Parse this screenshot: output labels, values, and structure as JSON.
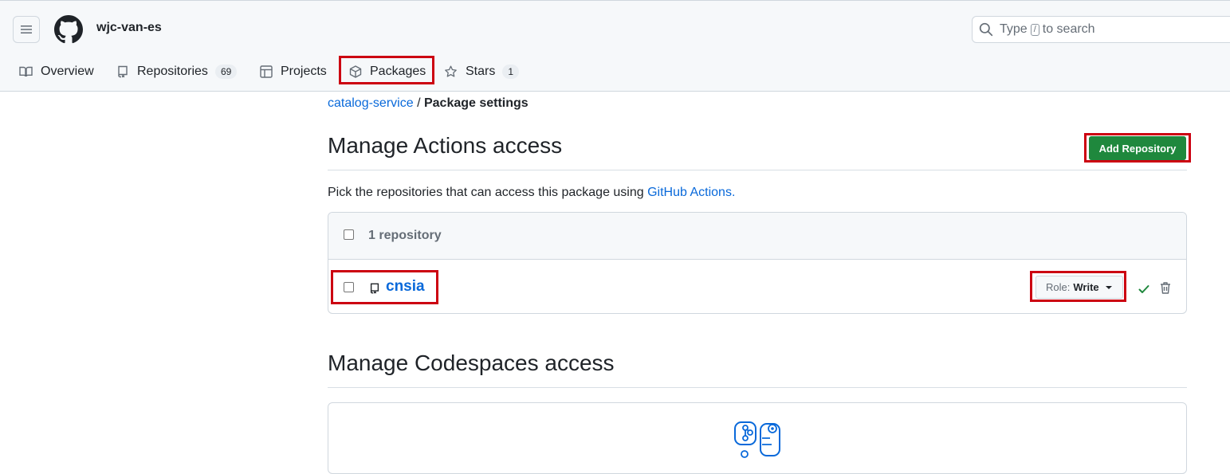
{
  "header": {
    "owner": "wjc-van-es",
    "search": {
      "prefix": "Type",
      "key": "/",
      "suffix": "to search"
    }
  },
  "tabs": [
    {
      "label": "Overview",
      "icon": "book-icon"
    },
    {
      "label": "Repositories",
      "icon": "repo-icon",
      "count": "69"
    },
    {
      "label": "Projects",
      "icon": "table-icon"
    },
    {
      "label": "Packages",
      "icon": "package-icon"
    },
    {
      "label": "Stars",
      "icon": "star-icon",
      "count": "1"
    }
  ],
  "breadcrumb": {
    "link": "catalog-service",
    "separator": "/",
    "current": "Package settings"
  },
  "actions_section": {
    "title": "Manage Actions access",
    "add_button": "Add Repository",
    "description": "Pick the repositories that can access this package using",
    "description_link": "GitHub Actions.",
    "header_count": "1 repository",
    "repos": [
      {
        "name": "cnsia",
        "role_label": "Role:",
        "role_value": "Write"
      }
    ]
  },
  "codespaces_section": {
    "title": "Manage Codespaces access"
  },
  "colors": {
    "accent": "#0969da",
    "primary_button": "#1f883d",
    "highlight": "#cc0011"
  }
}
